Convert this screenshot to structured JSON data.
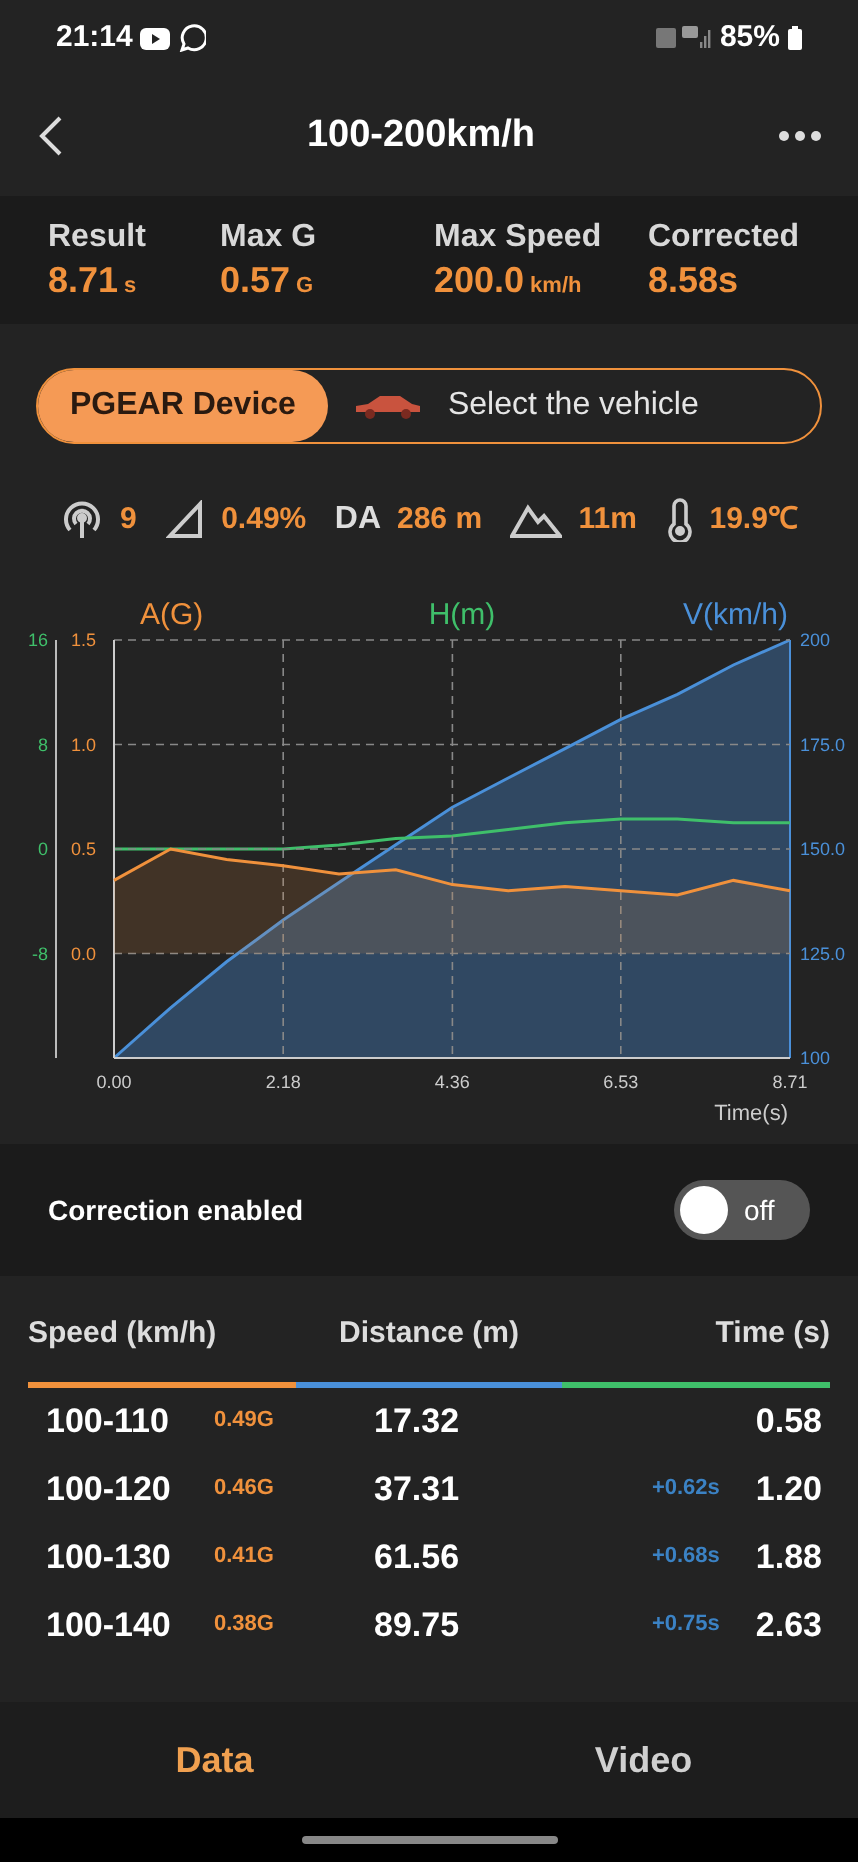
{
  "status_bar": {
    "time": "21:14",
    "battery": "85%"
  },
  "header": {
    "title": "100-200km/h"
  },
  "stats": [
    {
      "label": "Result",
      "value": "8.71",
      "unit": "s"
    },
    {
      "label": "Max G",
      "value": "0.57",
      "unit": "G"
    },
    {
      "label": "Max Speed",
      "value": "200.0",
      "unit": "km/h"
    },
    {
      "label": "Corrected",
      "value": "8.58s"
    }
  ],
  "source_switch": [
    {
      "label": "PGEAR Device",
      "selected": true
    },
    {
      "label": "Select the vehicle",
      "selected": false
    }
  ],
  "conditions": [
    {
      "kind": "satellites",
      "value": "9"
    },
    {
      "kind": "slope",
      "value": "0.49%"
    },
    {
      "kind": "label",
      "label": "DA",
      "value": "286 m"
    },
    {
      "kind": "altitude",
      "value": "11m"
    },
    {
      "kind": "temperature",
      "value": "19.9℃"
    }
  ],
  "chart": {
    "charts": [
      {
        "chart_data": {
          "type": "area",
          "xlabel": "Time(s)",
          "x": [
            0,
            0.73,
            1.45,
            2.18,
            2.9,
            3.63,
            4.36,
            5.08,
            5.81,
            6.53,
            7.26,
            7.98,
            8.71
          ],
          "xlim": [
            0,
            8.71
          ],
          "xticks": [
            {
              "value": 0,
              "label": "0.00"
            },
            {
              "value": 2.18,
              "label": "2.18"
            },
            {
              "value": 4.36,
              "label": "4.36"
            },
            {
              "value": 6.53,
              "label": "6.53"
            },
            {
              "value": 8.71,
              "label": "8.71"
            }
          ],
          "ylim": [
            -0.5,
            1.5
          ],
          "yticks": [
            {
              "value": 0,
              "label": "0.0"
            },
            {
              "value": 0.5,
              "label": "0.5"
            },
            {
              "value": 1,
              "label": "1.0"
            },
            {
              "value": 1.5,
              "label": "1.5"
            }
          ],
          "grid": true,
          "series": [
            {
              "name": "A(G)",
              "color": "#f0913c",
              "values": [
                0.35,
                0.5,
                0.45,
                0.42,
                0.38,
                0.4,
                0.33,
                0.3,
                0.32,
                0.3,
                0.28,
                0.35,
                0.3
              ]
            }
          ]
        }
      },
      {
        "chart_data": {
          "type": "line",
          "x": [
            0,
            0.73,
            1.45,
            2.18,
            2.9,
            3.63,
            4.36,
            5.08,
            5.81,
            6.53,
            7.26,
            7.98,
            8.71
          ],
          "xlim": [
            0,
            8.71
          ],
          "ylim": [
            -16,
            16
          ],
          "yticks": [
            {
              "value": -8,
              "label": "-8"
            },
            {
              "value": 0,
              "label": "0"
            },
            {
              "value": 8,
              "label": "8"
            },
            {
              "value": 16,
              "label": "16"
            }
          ],
          "series": [
            {
              "name": "H(m)",
              "color": "#3fbf6a",
              "values": [
                0,
                0,
                0,
                0,
                0.3,
                0.8,
                1,
                1.5,
                2,
                2.3,
                2.3,
                2,
                2
              ]
            }
          ]
        }
      },
      {
        "chart_data": {
          "type": "area",
          "x": [
            0,
            0.73,
            1.45,
            2.18,
            2.9,
            3.63,
            4.36,
            5.08,
            5.81,
            6.53,
            7.26,
            7.98,
            8.71
          ],
          "xlim": [
            0,
            8.71
          ],
          "ylim": [
            100,
            200
          ],
          "yticks": [
            {
              "value": 100,
              "label": "100"
            },
            {
              "value": 125,
              "label": "125.0"
            },
            {
              "value": 150,
              "label": "150.0"
            },
            {
              "value": 175,
              "label": "175.0"
            },
            {
              "value": 200,
              "label": "200"
            }
          ],
          "series": [
            {
              "name": "V(km/h)",
              "color": "#4a90d9",
              "values": [
                100,
                112,
                123,
                133,
                142,
                151,
                160,
                167,
                174,
                181,
                187,
                194,
                200
              ]
            }
          ]
        }
      }
    ]
  },
  "correction": {
    "label": "Correction enabled",
    "on": false,
    "state_text": "off"
  },
  "table": {
    "columns": [
      "Speed (km/h)",
      "Distance (m)",
      "Time (s)"
    ],
    "rows": [
      {
        "speed": "100-110",
        "g": "0.49G",
        "distance": "17.32",
        "time": "0.58"
      },
      {
        "speed": "100-120",
        "g": "0.46G",
        "distance": "37.31",
        "diff": "+0.62s",
        "time": "1.20"
      },
      {
        "speed": "100-130",
        "g": "0.41G",
        "distance": "61.56",
        "diff": "+0.68s",
        "time": "1.88"
      },
      {
        "speed": "100-140",
        "g": "0.38G",
        "distance": "89.75",
        "diff": "+0.75s",
        "time": "2.63"
      }
    ]
  },
  "bottom_tabs": [
    {
      "label": "Data",
      "selected": true
    },
    {
      "label": "Video",
      "selected": false
    }
  ]
}
